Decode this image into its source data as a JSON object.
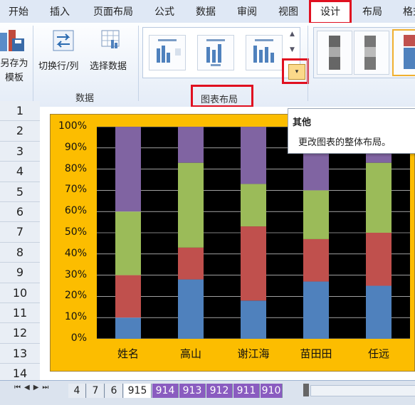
{
  "ribbon_tabs": [
    {
      "label": "开始"
    },
    {
      "label": "插入"
    },
    {
      "label": "页面布局"
    },
    {
      "label": "公式"
    },
    {
      "label": "数据"
    },
    {
      "label": "审阅"
    },
    {
      "label": "视图"
    },
    {
      "label": "设计"
    },
    {
      "label": "布局"
    },
    {
      "label": "格式"
    }
  ],
  "active_tab": "设计",
  "ribbon": {
    "save_as_template": "另存为\n模板",
    "switch_row_col": "切换行/列",
    "select_data": "选择数据",
    "data_group": "数据",
    "layout_group": "图表布局"
  },
  "tooltip": {
    "title": "其他",
    "body": "更改图表的整体布局。"
  },
  "rows": [
    "1",
    "2",
    "3",
    "4",
    "5",
    "6",
    "7",
    "8",
    "9",
    "10",
    "11",
    "12",
    "13",
    "14"
  ],
  "chart_data": {
    "type": "bar",
    "stacked": "percent",
    "categories": [
      "姓名",
      "高山",
      "谢江海",
      "苗田田",
      "任远"
    ],
    "yticks": [
      "0%",
      "10%",
      "20%",
      "30%",
      "40%",
      "50%",
      "60%",
      "70%",
      "80%",
      "90%",
      "100%"
    ],
    "ylim": [
      0,
      100
    ],
    "series": [
      {
        "color": "#4f81bd",
        "values": [
          10,
          28,
          18,
          27,
          25
        ]
      },
      {
        "color": "#c0504d",
        "values": [
          20,
          15,
          35,
          20,
          25
        ]
      },
      {
        "color": "#9bbb59",
        "values": [
          30,
          40,
          20,
          23,
          33
        ]
      },
      {
        "color": "#8064a2",
        "values": [
          40,
          17,
          27,
          30,
          17
        ]
      }
    ],
    "plot_background": "#000000",
    "chart_background": "#fcbd00"
  },
  "sheet_tabs": [
    "4",
    "7",
    "6",
    "915",
    "914",
    "913",
    "912",
    "911",
    "910"
  ],
  "active_sheet": "915"
}
